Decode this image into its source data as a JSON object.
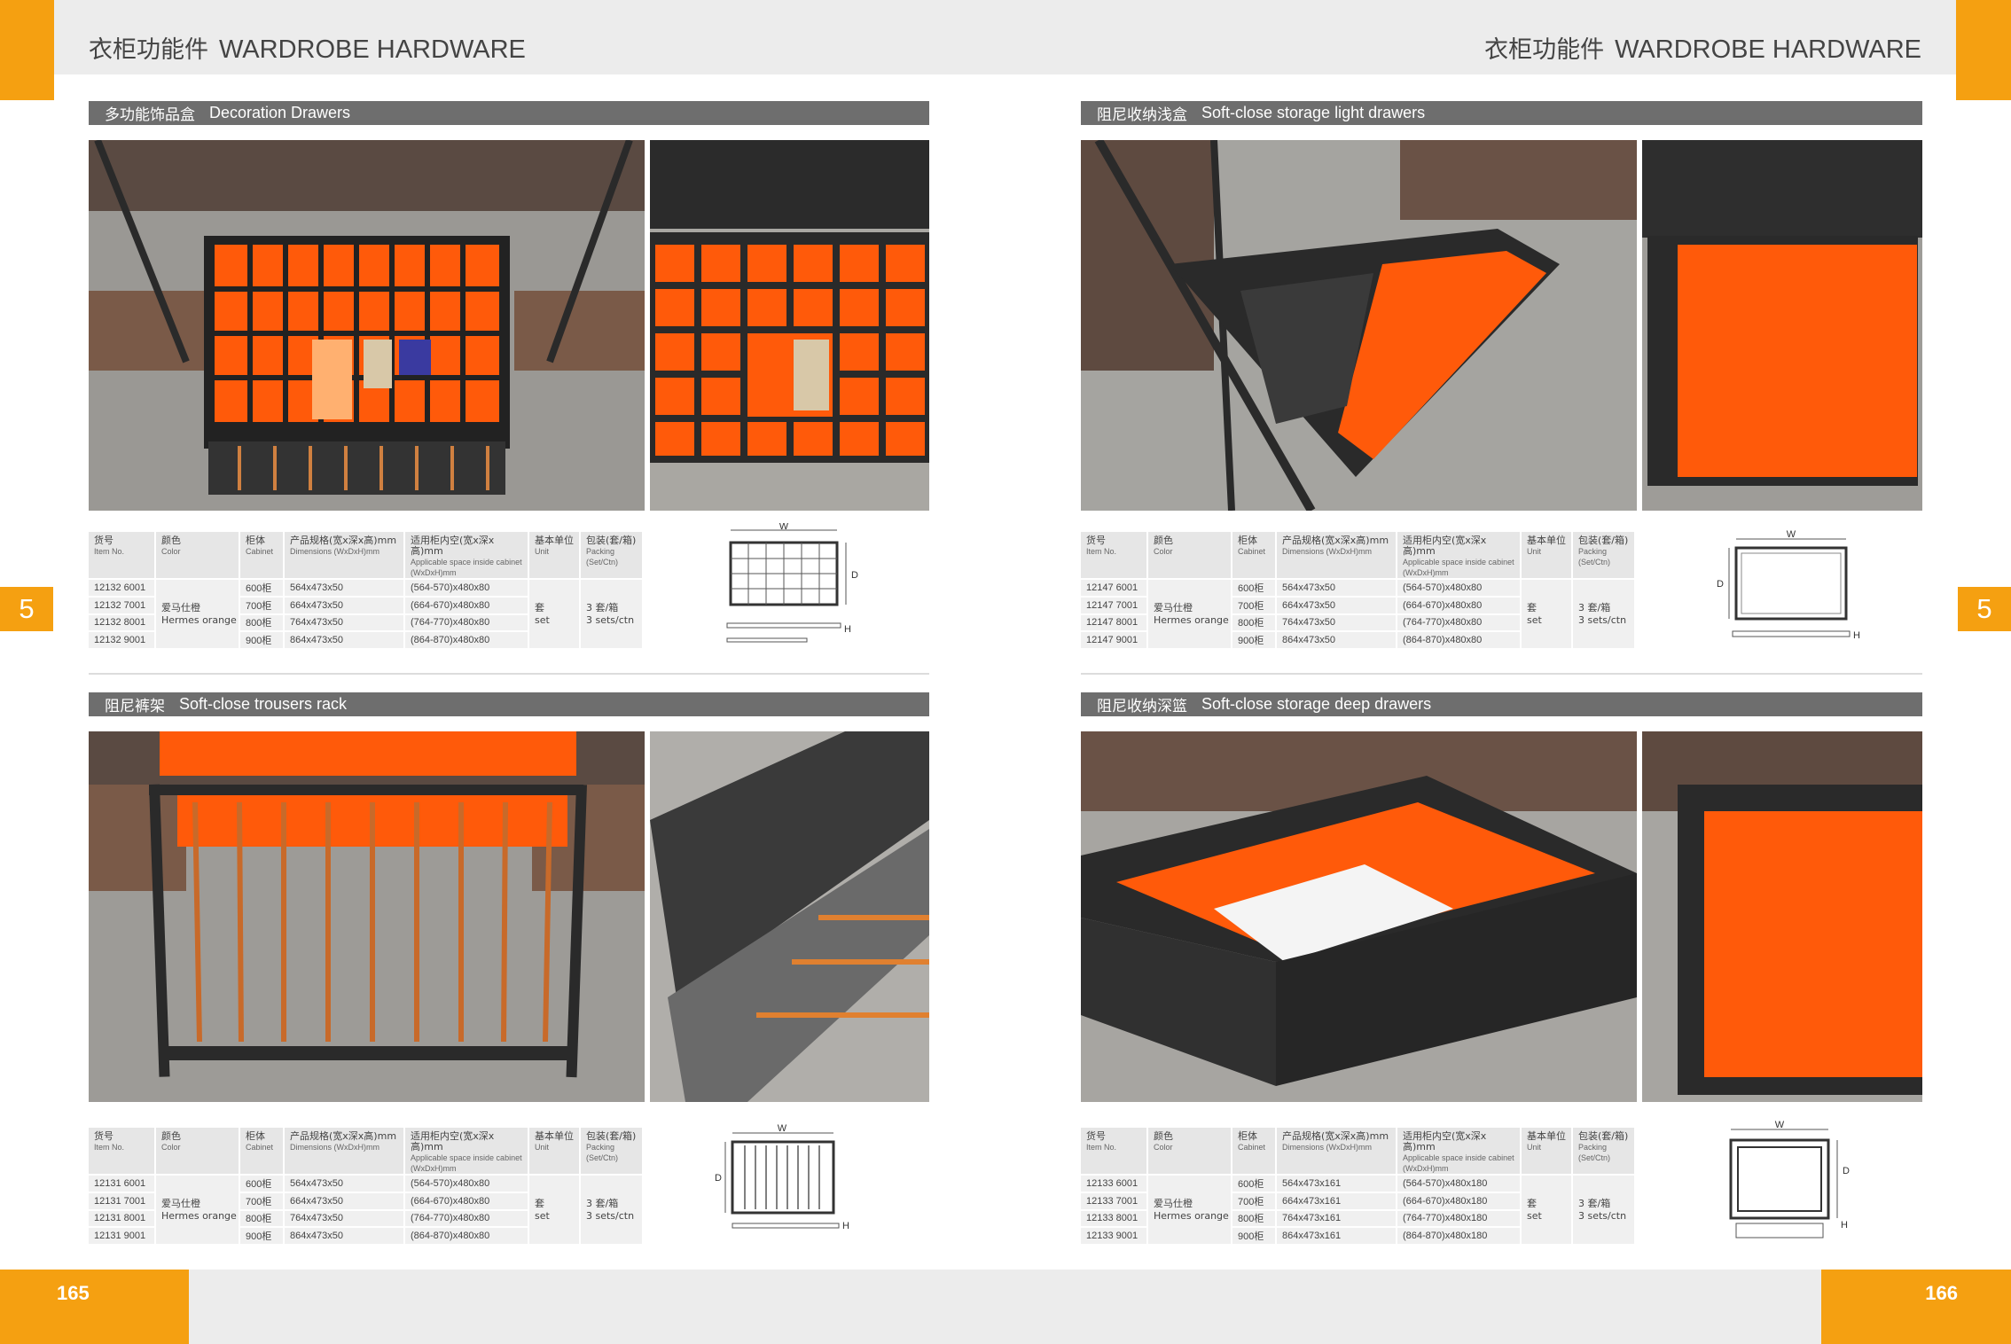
{
  "header": {
    "title_cn": "衣柜功能件",
    "title_en": "WARDROBE HARDWARE"
  },
  "side_tab": {
    "left": "5",
    "right": "5"
  },
  "footer": {
    "page_left": "165",
    "page_right": "166"
  },
  "colors": {
    "accent": "#f5a011",
    "section_bar": "#6e6e6e",
    "product_orange": "#ff5a0a",
    "frame": "#2a2a2a"
  },
  "table_headers": {
    "item": {
      "cn": "货号",
      "en": "Item No."
    },
    "color": {
      "cn": "颜色",
      "en": "Color"
    },
    "cabinet": {
      "cn": "柜体",
      "en": "Cabinet"
    },
    "dimensions": {
      "cn": "产品规格(宽x深x高)mm",
      "en": "Dimensions (WxDxH)mm"
    },
    "space": {
      "cn": "适用柜内空(宽x深x高)mm",
      "en": "Applicable space inside cabinet (WxDxH)mm"
    },
    "unit": {
      "cn": "基本单位",
      "en": "Unit"
    },
    "packing": {
      "cn": "包装(套/箱)",
      "en": "Packing (Set/Ctn)"
    }
  },
  "sections": [
    {
      "title_cn": "多功能饰品盒",
      "title_en": "Decoration Drawers",
      "color_cn": "爱马仕橙",
      "color_en": "Hermes orange",
      "unit_cn": "套",
      "unit_en": "set",
      "packing_cn": "3 套/箱",
      "packing_en": "3 sets/ctn",
      "diagram": {
        "w": "W",
        "d": "D",
        "h": "H"
      },
      "rows": [
        {
          "item": "12132 6001",
          "cabinet": "600柜",
          "dim": "564x473x50",
          "space": "(564-570)x480x80"
        },
        {
          "item": "12132 7001",
          "cabinet": "700柜",
          "dim": "664x473x50",
          "space": "(664-670)x480x80"
        },
        {
          "item": "12132 8001",
          "cabinet": "800柜",
          "dim": "764x473x50",
          "space": "(764-770)x480x80"
        },
        {
          "item": "12132 9001",
          "cabinet": "900柜",
          "dim": "864x473x50",
          "space": "(864-870)x480x80"
        }
      ]
    },
    {
      "title_cn": "阻尼收纳浅盒",
      "title_en": "Soft-close storage light drawers",
      "color_cn": "爱马仕橙",
      "color_en": "Hermes orange",
      "unit_cn": "套",
      "unit_en": "set",
      "packing_cn": "3 套/箱",
      "packing_en": "3 sets/ctn",
      "diagram": {
        "w": "W",
        "d": "D",
        "h": "H"
      },
      "rows": [
        {
          "item": "12147 6001",
          "cabinet": "600柜",
          "dim": "564x473x50",
          "space": "(564-570)x480x80"
        },
        {
          "item": "12147 7001",
          "cabinet": "700柜",
          "dim": "664x473x50",
          "space": "(664-670)x480x80"
        },
        {
          "item": "12147 8001",
          "cabinet": "800柜",
          "dim": "764x473x50",
          "space": "(764-770)x480x80"
        },
        {
          "item": "12147 9001",
          "cabinet": "900柜",
          "dim": "864x473x50",
          "space": "(864-870)x480x80"
        }
      ]
    },
    {
      "title_cn": "阻尼裤架",
      "title_en": "Soft-close trousers rack",
      "color_cn": "爱马仕橙",
      "color_en": "Hermes orange",
      "unit_cn": "套",
      "unit_en": "set",
      "packing_cn": "3 套/箱",
      "packing_en": "3 sets/ctn",
      "diagram": {
        "w": "W",
        "d": "D",
        "h": "H"
      },
      "rows": [
        {
          "item": "12131 6001",
          "cabinet": "600柜",
          "dim": "564x473x50",
          "space": "(564-570)x480x80"
        },
        {
          "item": "12131 7001",
          "cabinet": "700柜",
          "dim": "664x473x50",
          "space": "(664-670)x480x80"
        },
        {
          "item": "12131 8001",
          "cabinet": "800柜",
          "dim": "764x473x50",
          "space": "(764-770)x480x80"
        },
        {
          "item": "12131 9001",
          "cabinet": "900柜",
          "dim": "864x473x50",
          "space": "(864-870)x480x80"
        }
      ]
    },
    {
      "title_cn": "阻尼收纳深篮",
      "title_en": "Soft-close storage deep drawers",
      "color_cn": "爱马仕橙",
      "color_en": "Hermes orange",
      "unit_cn": "套",
      "unit_en": "set",
      "packing_cn": "3 套/箱",
      "packing_en": "3 sets/ctn",
      "diagram": {
        "w": "W",
        "d": "D",
        "h": "H"
      },
      "rows": [
        {
          "item": "12133 6001",
          "cabinet": "600柜",
          "dim": "564x473x161",
          "space": "(564-570)x480x180"
        },
        {
          "item": "12133 7001",
          "cabinet": "700柜",
          "dim": "664x473x161",
          "space": "(664-670)x480x180"
        },
        {
          "item": "12133 8001",
          "cabinet": "800柜",
          "dim": "764x473x161",
          "space": "(764-770)x480x180"
        },
        {
          "item": "12133 9001",
          "cabinet": "900柜",
          "dim": "864x473x161",
          "space": "(864-870)x480x180"
        }
      ]
    }
  ]
}
